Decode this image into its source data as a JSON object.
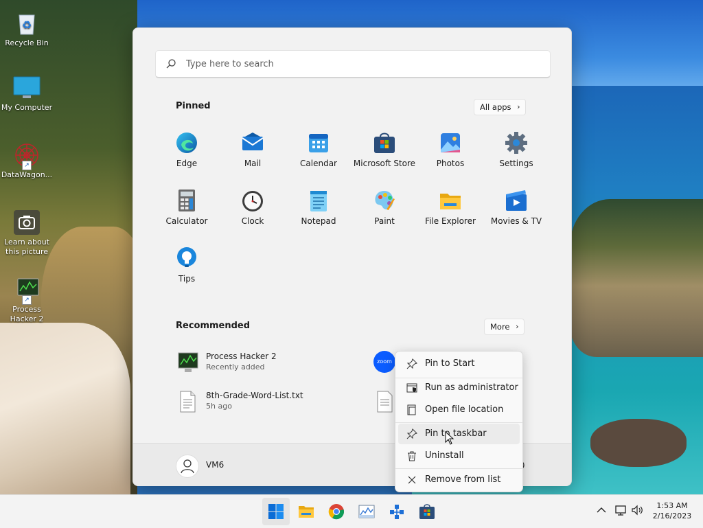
{
  "desktop": {
    "icons": [
      {
        "label": "Recycle Bin"
      },
      {
        "label": "My Computer"
      },
      {
        "label": "DataWagon..."
      },
      {
        "label": "Learn about this picture"
      },
      {
        "label": "Process Hacker 2"
      }
    ]
  },
  "start_menu": {
    "search": {
      "placeholder": "Type here to search"
    },
    "pinned": {
      "title": "Pinned",
      "all_apps_label": "All apps",
      "apps": [
        {
          "label": "Edge"
        },
        {
          "label": "Mail"
        },
        {
          "label": "Calendar"
        },
        {
          "label": "Microsoft Store"
        },
        {
          "label": "Photos"
        },
        {
          "label": "Settings"
        },
        {
          "label": "Calculator"
        },
        {
          "label": "Clock"
        },
        {
          "label": "Notepad"
        },
        {
          "label": "Paint"
        },
        {
          "label": "File Explorer"
        },
        {
          "label": "Movies & TV"
        },
        {
          "label": "Tips"
        }
      ]
    },
    "recommended": {
      "title": "Recommended",
      "more_label": "More",
      "items": [
        {
          "name": "Process Hacker 2",
          "sub": "Recently added"
        },
        {
          "name": "8th-Grade-Word-List.txt",
          "sub": "5h ago"
        }
      ],
      "zoom_badge": "zoom"
    },
    "user": {
      "name": "VM6"
    }
  },
  "context_menu": {
    "items": [
      {
        "label": "Pin to Start"
      },
      {
        "label": "Run as administrator"
      },
      {
        "label": "Open file location"
      },
      {
        "label": "Pin to taskbar"
      },
      {
        "label": "Uninstall"
      },
      {
        "label": "Remove from list"
      }
    ],
    "highlighted_index": 3
  },
  "taskbar": {
    "time": "1:53 AM",
    "date": "2/16/2023"
  },
  "colors": {
    "accent": "#0067c0",
    "start_bg": "#f2f2f2",
    "taskbar_bg": "#f3f3f3"
  }
}
